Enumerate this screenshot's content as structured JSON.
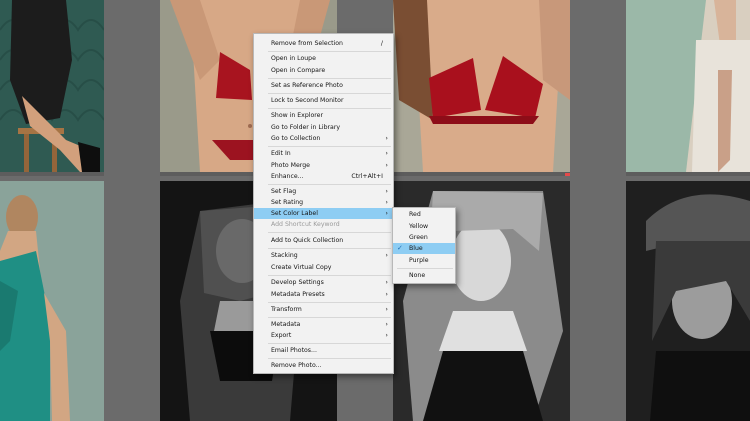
{
  "context_menu": {
    "items": [
      {
        "label": "Remove from Selection",
        "shortcut": "/"
      },
      {
        "label": "Open in Loupe"
      },
      {
        "label": "Open in Compare"
      },
      {
        "label": "Set as Reference Photo"
      },
      {
        "label": "Lock to Second Monitor"
      },
      {
        "label": "Show in Explorer"
      },
      {
        "label": "Go to Folder in Library"
      },
      {
        "label": "Go to Collection"
      },
      {
        "label": "Edit In"
      },
      {
        "label": "Photo Merge"
      },
      {
        "label": "Enhance...",
        "shortcut": "Ctrl+Alt+I"
      },
      {
        "label": "Set Flag"
      },
      {
        "label": "Set Rating"
      },
      {
        "label": "Set Color Label"
      },
      {
        "label": "Add Shortcut Keyword"
      },
      {
        "label": "Add to Quick Collection"
      },
      {
        "label": "Stacking"
      },
      {
        "label": "Create Virtual Copy"
      },
      {
        "label": "Develop Settings"
      },
      {
        "label": "Metadata Presets"
      },
      {
        "label": "Transform"
      },
      {
        "label": "Metadata"
      },
      {
        "label": "Export"
      },
      {
        "label": "Email Photos..."
      },
      {
        "label": "Remove Photo..."
      }
    ]
  },
  "color_label_submenu": {
    "items": [
      {
        "label": "Red"
      },
      {
        "label": "Yellow"
      },
      {
        "label": "Green"
      },
      {
        "label": "Blue"
      },
      {
        "label": "Purple"
      },
      {
        "label": "None"
      }
    ],
    "checked": "Blue"
  },
  "colors": {
    "menu_bg": "#f2f2f2",
    "highlight": "#8ecdf3",
    "grid_bg": "#6b6b6b",
    "selected_strip": "#e44a4a"
  }
}
